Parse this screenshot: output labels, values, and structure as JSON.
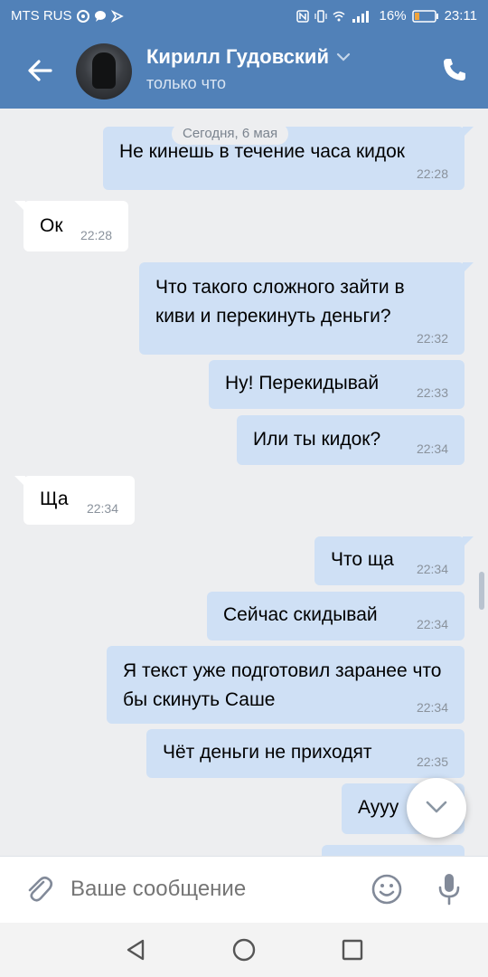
{
  "status_bar": {
    "carrier": "MTS RUS",
    "battery": "16%",
    "time": "23:11"
  },
  "header": {
    "name": "Кирилл Гудовский",
    "status": "только что"
  },
  "chat": {
    "date_chip": "Сегодня, 6 мая",
    "messages": [
      {
        "dir": "out",
        "text": "Не кинешь в течение часа кидок",
        "time": "22:28"
      },
      {
        "dir": "in",
        "text": "Ок",
        "time": "22:28"
      },
      {
        "dir": "out",
        "text": "Что такого сложного зайти в киви и перекинуть деньги?",
        "time": "22:32"
      },
      {
        "dir": "out",
        "text": "Ну! Перекидывай",
        "time": "22:33"
      },
      {
        "dir": "out",
        "text": "Или ты кидок?",
        "time": "22:34"
      },
      {
        "dir": "in",
        "text": "Ща",
        "time": "22:34"
      },
      {
        "dir": "out",
        "text": "Что ща",
        "time": "22:34"
      },
      {
        "dir": "out",
        "text": "Сейчас скидывай",
        "time": "22:34"
      },
      {
        "dir": "out",
        "text": "Я текст уже подготовил заранее что бы скинуть Саше",
        "time": "22:34"
      },
      {
        "dir": "out",
        "text": "Чёт деньги не приходят",
        "time": "22:35"
      },
      {
        "dir": "out",
        "text": "Аууу",
        "time": ""
      }
    ]
  },
  "composer": {
    "placeholder": "Ваше сообщение"
  },
  "colors": {
    "accent": "#5181b8",
    "outgoing_bubble": "#cfe0f5",
    "incoming_bubble": "#ffffff",
    "chat_background": "#edeef0"
  }
}
